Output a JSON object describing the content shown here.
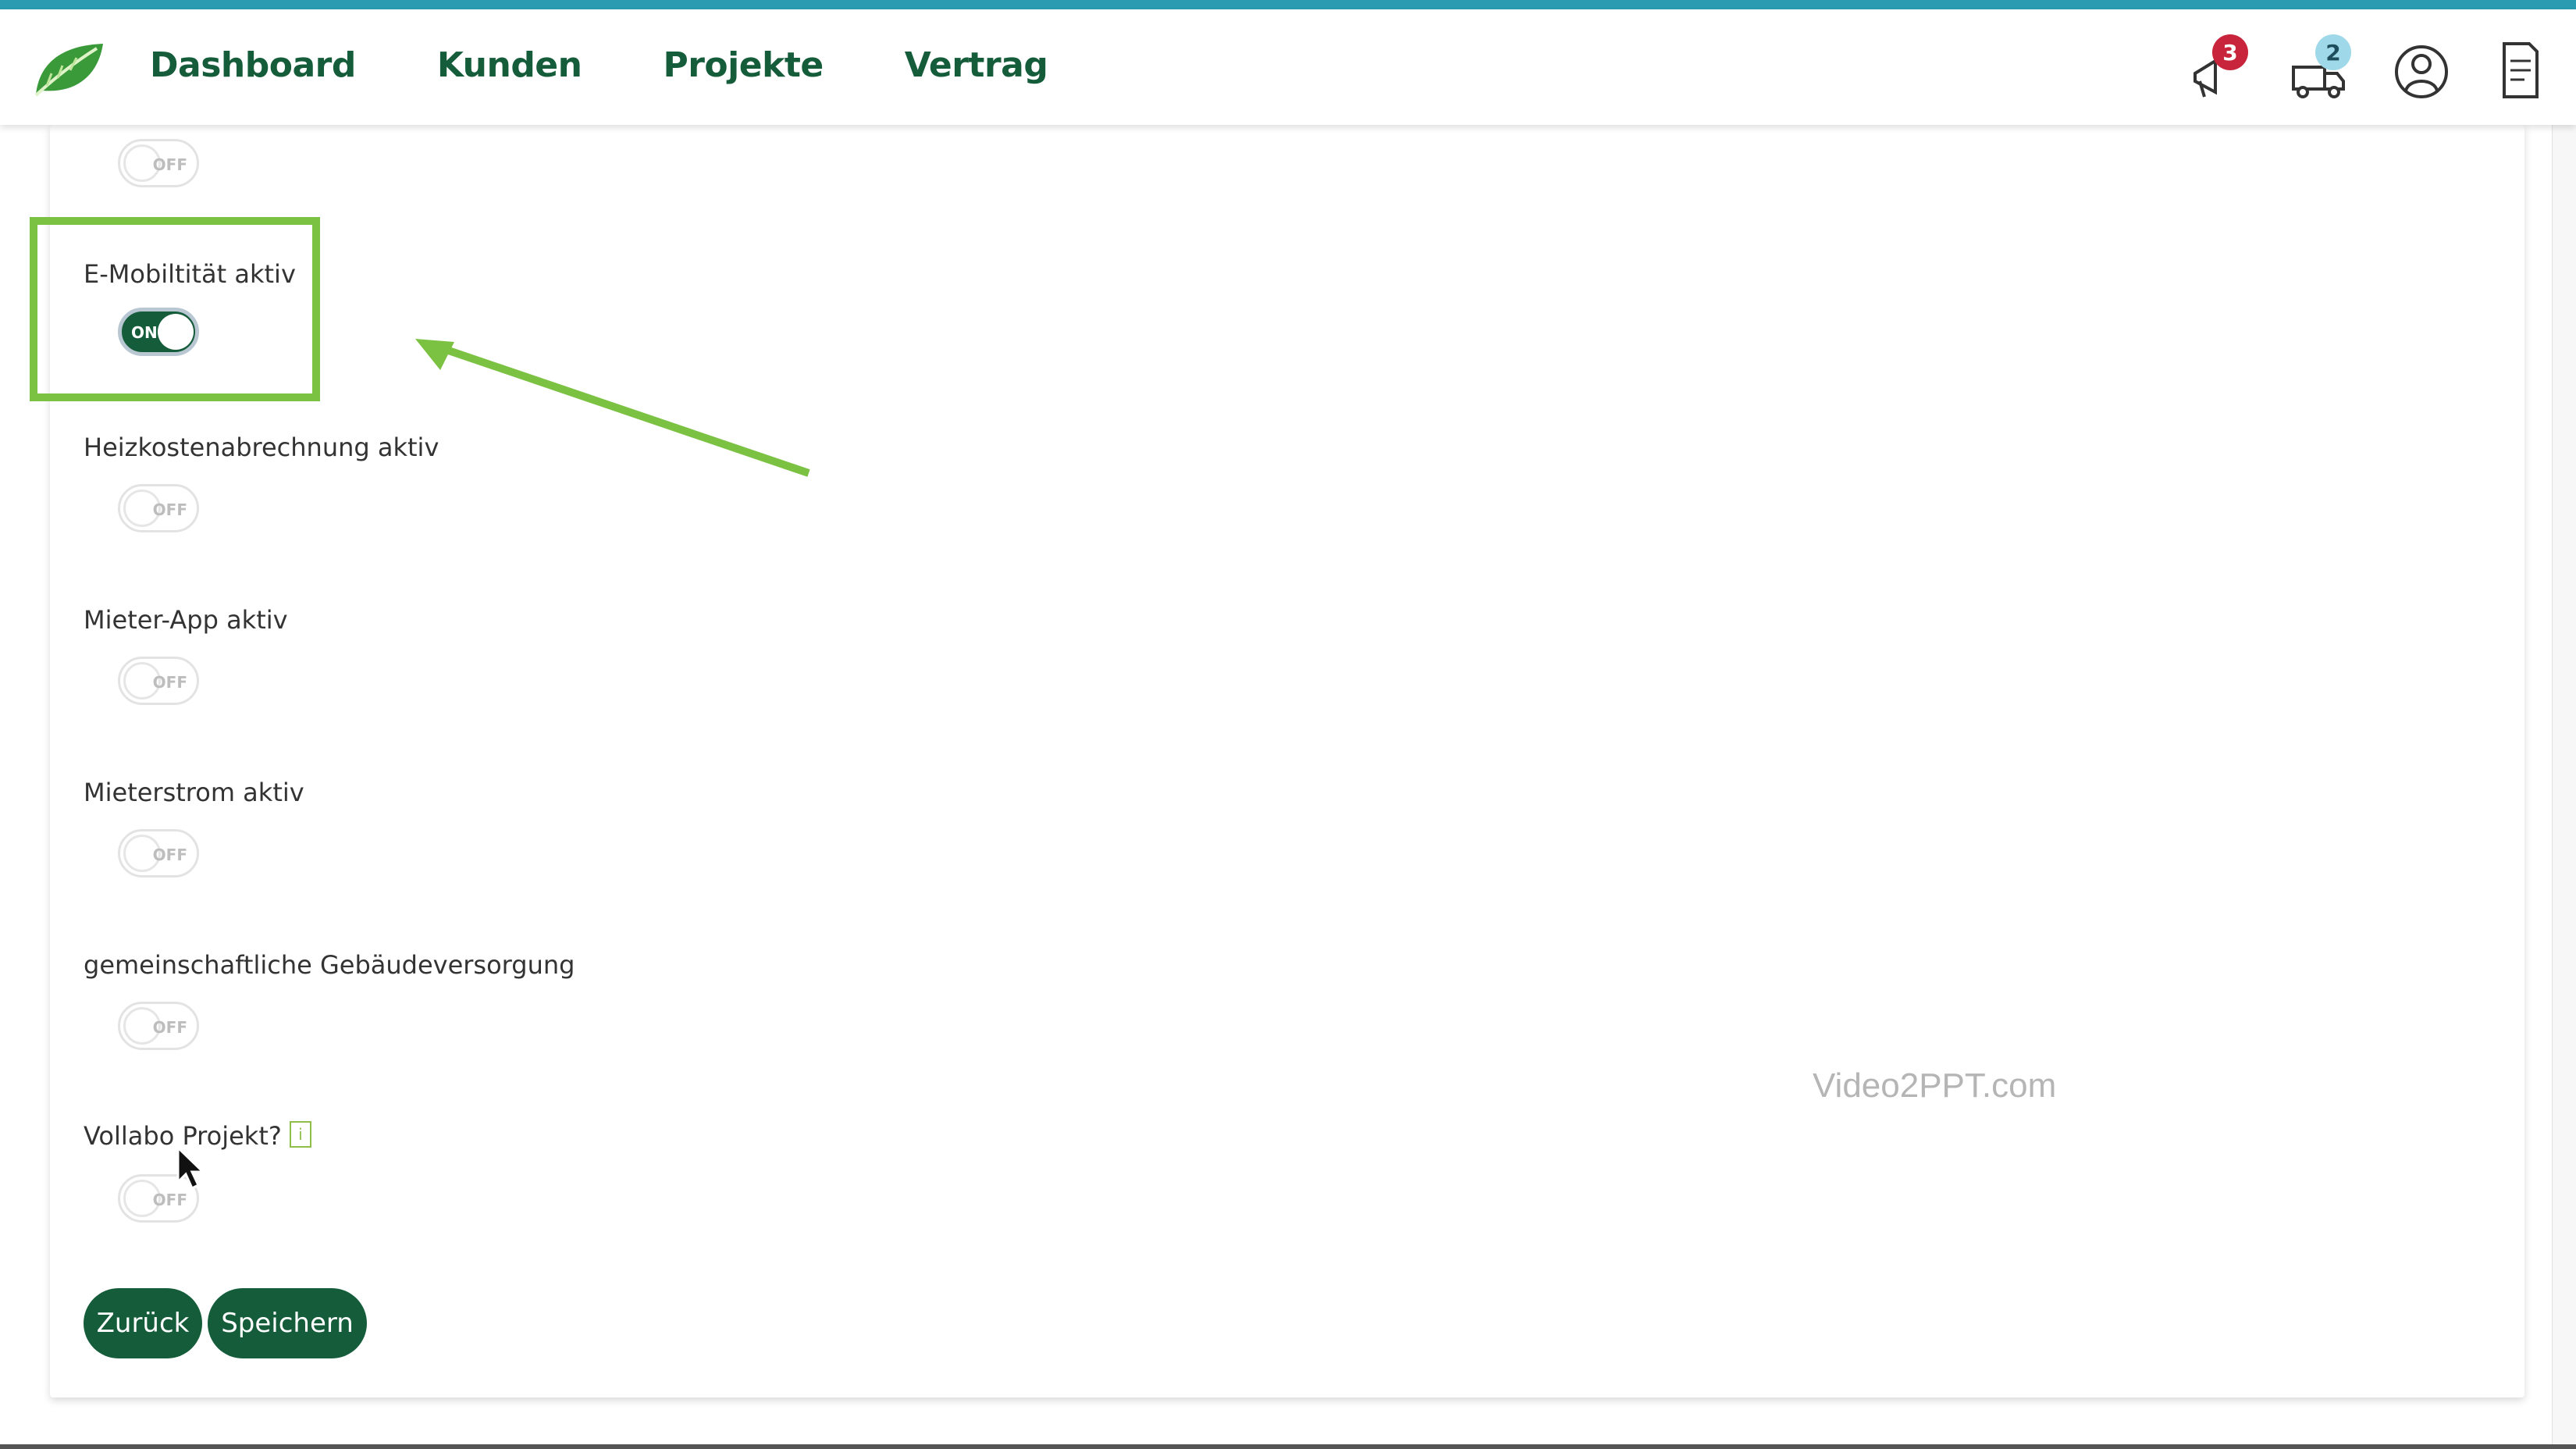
{
  "nav": {
    "items": [
      {
        "label": "Dashboard"
      },
      {
        "label": "Kunden"
      },
      {
        "label": "Projekte"
      },
      {
        "label": "Vertrag"
      }
    ]
  },
  "header_icons": {
    "notifications_count": "3",
    "messages_count": "2"
  },
  "toggles": {
    "top": {
      "state": "OFF"
    },
    "emobility": {
      "label": "E-Mobiltität aktiv",
      "state": "ON"
    },
    "heating": {
      "label": "Heizkostenabrechnung aktiv",
      "state": "OFF"
    },
    "tenant_app": {
      "label": "Mieter-App aktiv",
      "state": "OFF"
    },
    "tenant_power": {
      "label": "Mieterstrom aktiv",
      "state": "OFF"
    },
    "shared_supply": {
      "label": "gemeinschaftliche Gebäudeversorgung",
      "state": "OFF"
    },
    "vollabo": {
      "label": "Vollabo Projekt?",
      "info": "i",
      "state": "OFF"
    }
  },
  "buttons": {
    "back": "Zurück",
    "save": "Speichern"
  },
  "watermark": "Video2PPT.com",
  "colors": {
    "primary": "#145c3a",
    "accent": "#2a9bb0",
    "highlight": "#7bc142",
    "badge_red": "#c8243c",
    "badge_teal": "#9fd8e8"
  }
}
